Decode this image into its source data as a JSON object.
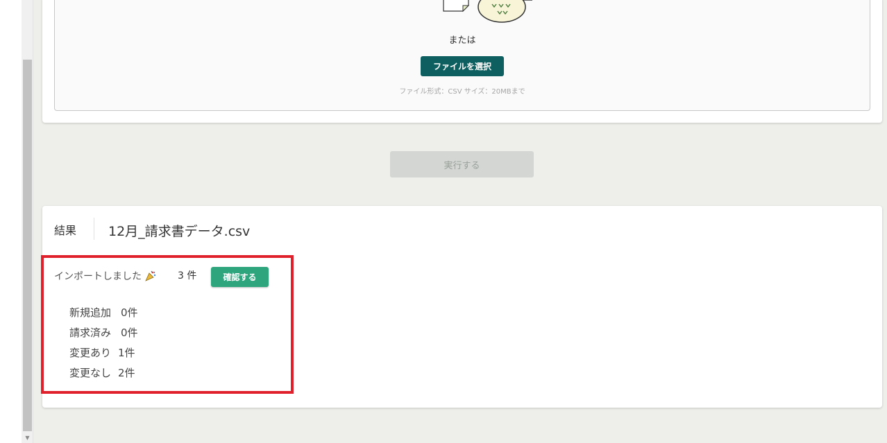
{
  "upload": {
    "or_text": "または",
    "select_file_label": "ファイルを選択",
    "file_hint": "ファイル形式：CSV サイズ：20MBまで"
  },
  "execute_label": "実行する",
  "result": {
    "label": "結果",
    "filename": "12月_請求書データ.csv",
    "import_message": "インポートしました",
    "import_count": "3 件",
    "confirm_label": "確認する",
    "stats": [
      {
        "label": "新規追加",
        "value": "0件"
      },
      {
        "label": "請求済み",
        "value": "0件"
      },
      {
        "label": "変更あり",
        "value": "1件"
      },
      {
        "label": "変更なし",
        "value": "2件"
      }
    ]
  },
  "colors": {
    "select_file_button": "#0d5f60",
    "confirm_button": "#2ea57c",
    "highlight": "#e0202b",
    "execute_disabled": "#d3d6d2"
  },
  "icons": [
    "document-icon",
    "owl-mascot-icon",
    "party-popper-icon",
    "scroll-down-arrow-icon"
  ]
}
